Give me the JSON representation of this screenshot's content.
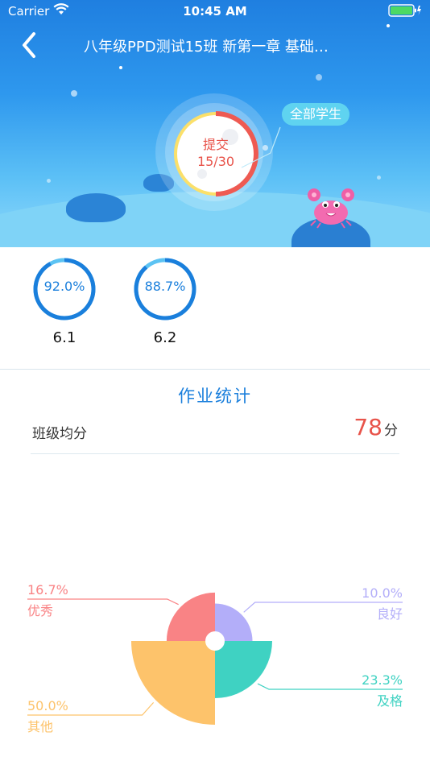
{
  "status_bar": {
    "carrier": "Carrier",
    "time": "10:45 AM"
  },
  "nav": {
    "title": "八年级PPD测试15班 新第一章 基础…"
  },
  "submission": {
    "label": "提交",
    "count": "15/30",
    "submitted": 15,
    "total": 30,
    "filter_button": "全部学生"
  },
  "stats": [
    {
      "percent_text": "92.0%",
      "percent": 92.0,
      "label": "6.1"
    },
    {
      "percent_text": "88.7%",
      "percent": 88.7,
      "label": "6.2"
    }
  ],
  "homework": {
    "title": "作业统计",
    "avg_label": "班级均分",
    "avg_value": "78",
    "avg_unit": "分"
  },
  "chart_data": {
    "type": "pie",
    "slices": [
      {
        "name": "优秀",
        "value": 16.7,
        "label": "16.7%",
        "color": "#f98385"
      },
      {
        "name": "良好",
        "value": 10.0,
        "label": "10.0%",
        "color": "#b3aef9"
      },
      {
        "name": "及格",
        "value": 23.3,
        "label": "23.3%",
        "color": "#3fd2c2"
      },
      {
        "name": "其他",
        "value": 50.0,
        "label": "50.0%",
        "color": "#fdc36b"
      }
    ]
  },
  "colors": {
    "accent": "#1a7fdc",
    "danger": "#e8534a",
    "filter_bg": "#5fd3f0"
  },
  "icons": {
    "back": "chevron-left-icon",
    "wifi": "wifi-icon",
    "battery": "battery-icon",
    "mascot": "crab-mascot"
  }
}
